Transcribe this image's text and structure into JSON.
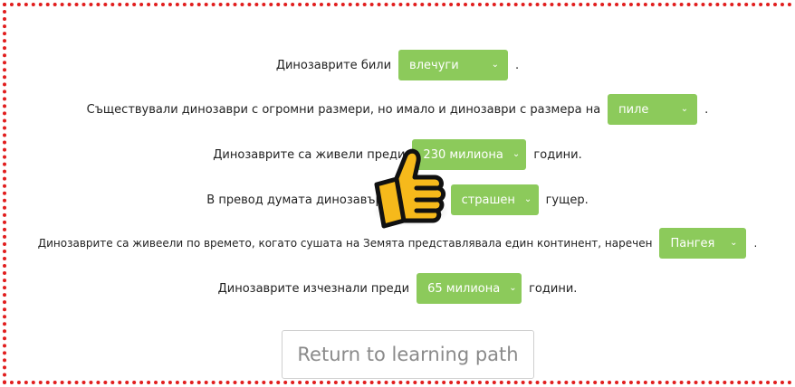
{
  "sentences": [
    {
      "before": "Динозаврите били",
      "selected": "влечуги",
      "after": "."
    },
    {
      "before": "Съществували динозаври с огромни размери, но имало и динозаври с размера на",
      "selected": "пиле",
      "after": "."
    },
    {
      "before": "Динозаврите са живели преди",
      "selected": "230 милиона",
      "after": "години."
    },
    {
      "before": "В превод думата динозавър означава",
      "selected": "страшен",
      "after": "гущер."
    },
    {
      "before": "Динозаврите са живеели по времето, когато сушата на Земята представлявала един континент, наречен",
      "selected": "Пангея",
      "after": "."
    },
    {
      "before": "Динозаврите изчезнали преди",
      "selected": "65 милиона",
      "after": "години."
    }
  ],
  "return_button_label": "Return to learning path",
  "icons": {
    "dropdown": "chevron-down-icon",
    "feedback": "thumbs-up-icon"
  },
  "colors": {
    "select_bg": "#8cca5b",
    "frame": "#e11d1d"
  }
}
